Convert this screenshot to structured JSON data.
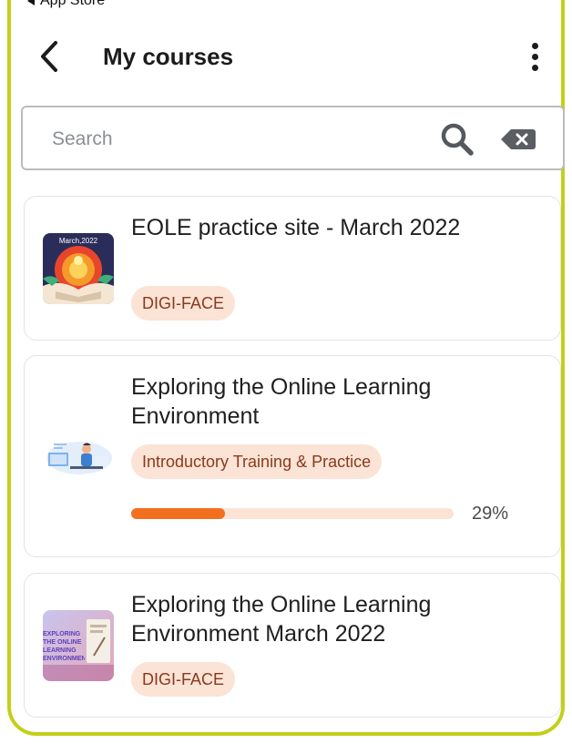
{
  "status_bar": {
    "back_label": "App Store"
  },
  "header": {
    "title": "My courses"
  },
  "search": {
    "placeholder": "Search",
    "value": ""
  },
  "courses": [
    {
      "title": "EOLE practice site - March 2022",
      "category": "DIGI-FACE",
      "thumbnail_label": "March,2022"
    },
    {
      "title": "Exploring the Online Learning Environment",
      "category": "Introductory Training & Practice",
      "progress_percent": 29,
      "progress_label": "29%"
    },
    {
      "title": "Exploring the Online Learning Environment March 2022",
      "category": "DIGI-FACE",
      "thumbnail_label": "EXPLORING THE ONLINE LEARNING ENVIRONMENT"
    }
  ],
  "colors": {
    "frame": "#c3cf1a",
    "badge_bg": "#fbe3d6",
    "badge_text": "#8a3a1c",
    "progress_fill": "#f26f1f",
    "progress_track": "#fbe3d6"
  }
}
